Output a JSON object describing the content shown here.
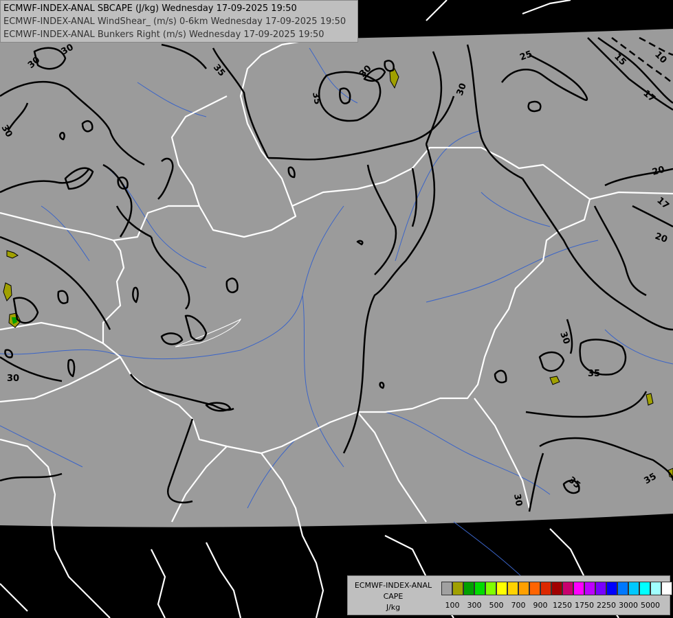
{
  "header": {
    "lines": [
      "ECMWF-INDEX-ANAL SBCAPE (J/kg) Wednesday 17-09-2025 19:50",
      "ECMWF-INDEX-ANAL WindShear_ (m/s) 0-6km Wednesday 17-09-2025 19:50",
      "ECMWF-INDEX-ANAL Bunkers Right (m/s) Wednesday 17-09-2025 19:50"
    ]
  },
  "legend": {
    "title_line1": "ECMWF-INDEX-ANAL",
    "title_line2": "CAPE",
    "unit": "J/kg",
    "colors": [
      "#a0a0a0",
      "#a0a000",
      "#00a000",
      "#00dc00",
      "#80ff00",
      "#ffff00",
      "#ffd200",
      "#ffa000",
      "#ff6400",
      "#dc2800",
      "#a00000",
      "#c8006e",
      "#ff00ff",
      "#be00ff",
      "#7800ff",
      "#0000ff",
      "#0078ff",
      "#00c8ff",
      "#00ffff",
      "#a0ffff",
      "#ffffff"
    ],
    "tick_labels": [
      "100",
      "300",
      "500",
      "700",
      "900",
      "1250",
      "1750",
      "2250",
      "3000",
      "5000"
    ]
  },
  "contour_labels": [
    "30",
    "35",
    "30",
    "25",
    "15",
    "10",
    "17",
    "30",
    "30",
    "35",
    "20",
    "17",
    "20",
    "30",
    "35",
    "30",
    "30",
    "35",
    "35",
    "30"
  ],
  "colors": {
    "domain_fill": "#9b9b9b",
    "outside": "#000000",
    "border": "#ffffff",
    "river": "#3a64c8",
    "contour": "#000000",
    "cape_low": "#a0a000",
    "cape_mid": "#00a000"
  }
}
